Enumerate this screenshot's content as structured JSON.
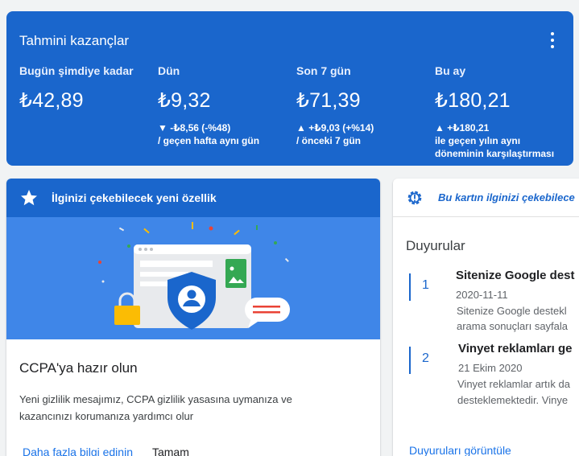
{
  "earnings": {
    "title": "Tahmini kazançlar",
    "columns": [
      {
        "label": "Bugün şimdiye kadar",
        "value": "₺42,89",
        "delta": "",
        "compare": ""
      },
      {
        "label": "Dün",
        "value": "₺9,32",
        "delta": "▼ -₺8,56 (-%48)",
        "compare": "/ geçen hafta aynı gün"
      },
      {
        "label": "Son 7 gün",
        "value": "₺71,39",
        "delta": "▲ +₺9,03 (+%14)",
        "compare": "/ önceki 7 gün"
      },
      {
        "label": "Bu ay",
        "value": "₺180,21",
        "delta": "▲ +₺180,21",
        "compare": "ile geçen yılın aynı döneminin karşılaştırması"
      }
    ]
  },
  "feature": {
    "header": "İlginizi çekebilecek yeni özellik",
    "heading": "CCPA'ya hazır olun",
    "body": "Yeni gizlilik mesajımız, CCPA gizlilik yasasına uymanıza ve kazancınızı korumanıza yardımcı olur",
    "learn_more": "Daha fazla bilgi edinin",
    "dismiss": "Tamam"
  },
  "announcements": {
    "header": "Bu kartın ilginizi çekebilece",
    "heading": "Duyurular",
    "items": [
      {
        "num": "1",
        "title": "Sitenize Google dest",
        "date": "2020-11-11",
        "desc1": "Sitenize Google destekl",
        "desc2": "arama sonuçları sayfala"
      },
      {
        "num": "2",
        "title": "Vinyet reklamları ge",
        "date": "21 Ekim 2020",
        "desc1": "Vinyet reklamlar artık da",
        "desc2": "desteklemektedir. Vinye"
      }
    ],
    "view_link": "Duyuruları görüntüle"
  },
  "colors": {
    "primary": "#1a66cc",
    "illustration_bg": "#3f86e8",
    "link": "#1a73e8"
  }
}
